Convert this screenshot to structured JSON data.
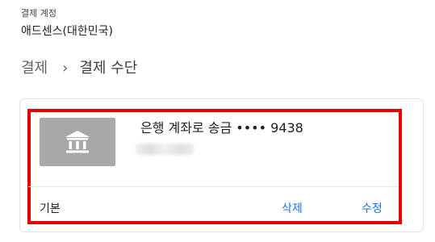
{
  "header": {
    "account_label": "결제 계정",
    "account_name": "애드센스(대한민국)"
  },
  "breadcrumb": {
    "parent": "결제",
    "separator": "›",
    "current": "결제 수단"
  },
  "payment_method": {
    "icon": "bank-icon",
    "title": "은행 계좌로 송금 •••• 9438",
    "status": "기본",
    "delete_label": "삭제",
    "edit_label": "수정"
  },
  "colors": {
    "highlight_border": "#e60000",
    "link": "#1a73e8",
    "tile": "#a8a8a8"
  }
}
